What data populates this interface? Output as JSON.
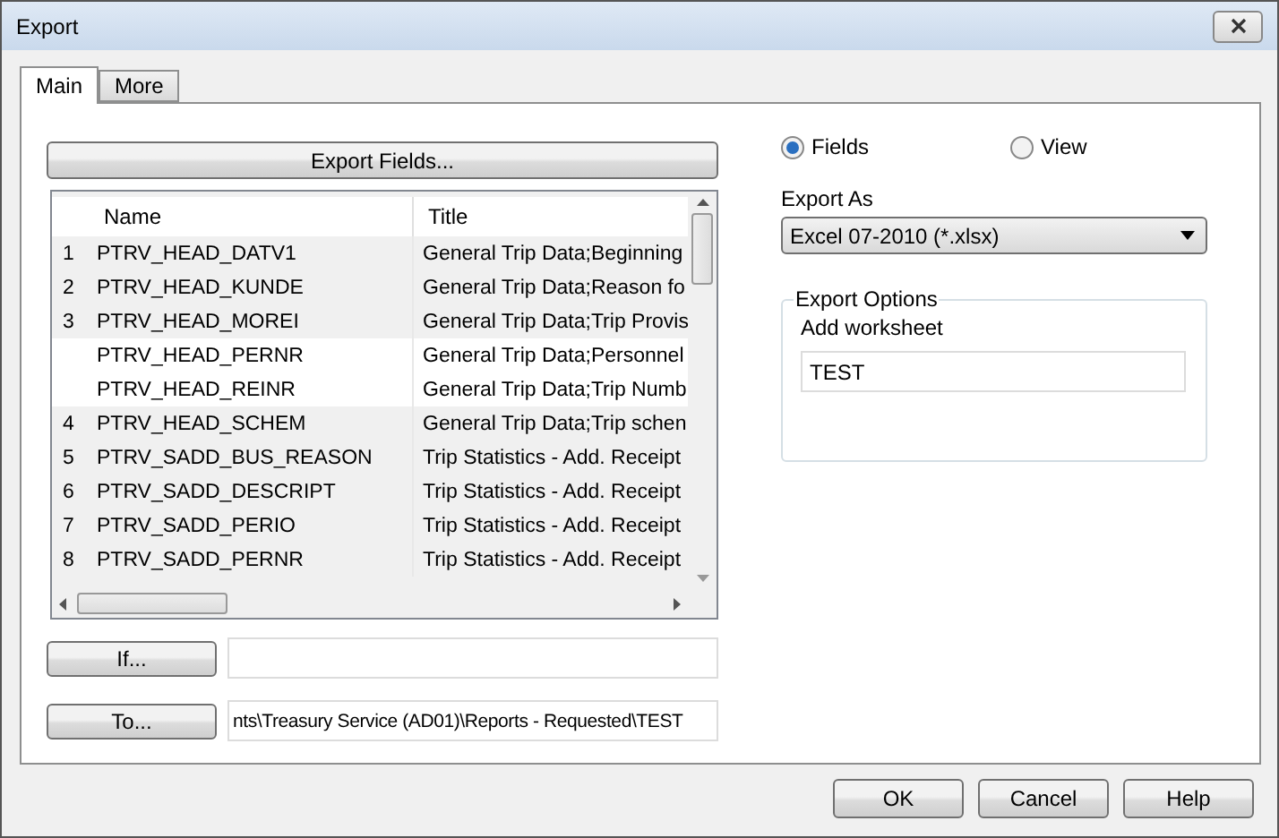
{
  "window": {
    "title": "Export"
  },
  "tabs": [
    {
      "label": "Main",
      "selected": true
    },
    {
      "label": "More",
      "selected": false
    }
  ],
  "export_fields_button": "Export Fields...",
  "table": {
    "columns": [
      "Name",
      "Title"
    ],
    "rows": [
      {
        "number": "1",
        "name": "PTRV_HEAD_DATV1",
        "title": "General Trip Data;Beginning",
        "selected": false
      },
      {
        "number": "2",
        "name": "PTRV_HEAD_KUNDE",
        "title": "General Trip Data;Reason fo",
        "selected": false
      },
      {
        "number": "3",
        "name": "PTRV_HEAD_MOREI",
        "title": "General Trip Data;Trip Provis",
        "selected": false
      },
      {
        "number": "",
        "name": "PTRV_HEAD_PERNR",
        "title": "General Trip Data;Personnel",
        "selected": true
      },
      {
        "number": "",
        "name": "PTRV_HEAD_REINR",
        "title": "General Trip Data;Trip Numb",
        "selected": true
      },
      {
        "number": "4",
        "name": "PTRV_HEAD_SCHEM",
        "title": "General Trip Data;Trip schen",
        "selected": false
      },
      {
        "number": "5",
        "name": "PTRV_SADD_BUS_REASON",
        "title": "Trip Statistics - Add. Receipt",
        "selected": false
      },
      {
        "number": "6",
        "name": "PTRV_SADD_DESCRIPT",
        "title": "Trip Statistics - Add. Receipt",
        "selected": false
      },
      {
        "number": "7",
        "name": "PTRV_SADD_PERIO",
        "title": "Trip Statistics - Add. Receipt",
        "selected": false
      },
      {
        "number": "8",
        "name": "PTRV_SADD_PERNR",
        "title": "Trip Statistics - Add. Receipt",
        "selected": false
      }
    ]
  },
  "if_button": "If...",
  "to_button": "To...",
  "to_value": "nts\\Treasury Service (AD01)\\Reports - Requested\\TEST",
  "source": [
    {
      "label": "Fields",
      "selected": true
    },
    {
      "label": "View",
      "selected": false
    }
  ],
  "export_as": {
    "label": "Export As",
    "value": "Excel 07-2010 (*.xlsx)"
  },
  "export_options": {
    "legend": "Export Options",
    "label": "Add worksheet",
    "value": "TEST"
  },
  "buttons": [
    "OK",
    "Cancel",
    "Help"
  ]
}
